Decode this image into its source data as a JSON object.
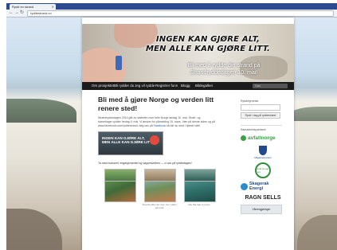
{
  "browser": {
    "tab_title": "Rydd en strand",
    "url": "ryddestrand.no"
  },
  "banner": {
    "slogan_line1": "INGEN KAN GJØRE ALT,",
    "slogan_line2": "MEN ALLE KAN GJØRE LITT.",
    "subline_line1": "Bli med å rydde din strand på",
    "subline_line2": "Strandryddedagen 10. mai!"
  },
  "menu": {
    "items": [
      "Om prosjektet",
      "Bli rydder du",
      "Jeg vil rydde",
      "Registrer funn",
      "Blogg",
      "Bildegalleri"
    ],
    "search_placeholder": "Søk"
  },
  "main": {
    "headline": "Bli med å gjøre Norge og verden litt renere sted!",
    "body_line1": "Strandryddedagen 2014 går av stabelen over hele Norge lørdag 10. mai. Skole- og",
    "body_line2": "barnehager rydder fredag 9. mai. Vi ønsker for påmelding 15. mars. Vær på denne siden og på",
    "body_line3": "www.facebook.com/ryddestrand, følg oss på",
    "body_link": "Facebook",
    "body_line3b": "så blir du med i hjertet vårt!",
    "cta_line1": "INGEN KAN GJØRE ALT,",
    "cta_line2": "MEN ALLE KAN GJØRE LITT.",
    "caption": "Ta med humøret, engasjementet og søppelsekken — vi ses på ryddedagen!",
    "thumb_captions": [
      "",
      "Strandrydder fra i fjor, her ryddet på Lista",
      "Alle fikk lagt ut poser"
    ]
  },
  "sidebar": {
    "search_label": "Ryddetjeneste",
    "search_button": "Rydd i dag på ryddestrand",
    "partners_label": "Samarbeidspartnere",
    "avfall_logo": "avfallnorge",
    "crest_caption": "Miljødirektoratet",
    "ring_text": "Hold Norge rent",
    "skagerak_line1": "Skagerak",
    "skagerak_line2": "Energi",
    "ragn_logo": "RAGN SELLS",
    "box_label": "Vårrengjøringer"
  },
  "colors": {
    "menubar": "#1b1b1b",
    "browser_tabstrip": "#2c4a8f",
    "link": "#1b5fb3",
    "avfall_green": "#3aa043"
  }
}
